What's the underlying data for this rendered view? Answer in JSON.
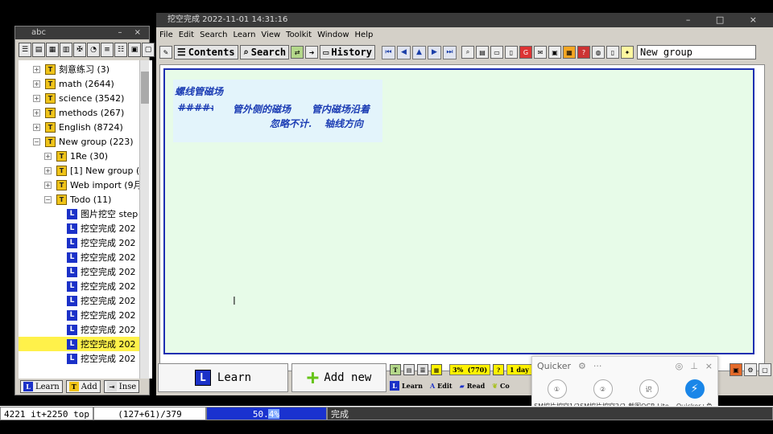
{
  "tree_window": {
    "title": "abc",
    "buttons": {
      "learn": "Learn",
      "add": "Add",
      "insert": "Inse"
    }
  },
  "tree": {
    "items": [
      {
        "label": "刻意练习 (3)"
      },
      {
        "label": "math (2644)"
      },
      {
        "label": "science (3542)"
      },
      {
        "label": "methods (267)"
      },
      {
        "label": "English (8724)"
      },
      {
        "label": "New group (223)"
      },
      {
        "label": "1Re (30)"
      },
      {
        "label": "[1] New group (1"
      },
      {
        "label": "Web import (9月"
      },
      {
        "label": "Todo (11)"
      },
      {
        "label": "图片挖空  step"
      },
      {
        "label": "挖空完成 202"
      },
      {
        "label": "挖空完成 202"
      },
      {
        "label": "挖空完成 202"
      },
      {
        "label": "挖空完成 202"
      },
      {
        "label": "挖空完成 202"
      },
      {
        "label": "挖空完成 202"
      },
      {
        "label": "挖空完成 202"
      },
      {
        "label": "挖空完成 202"
      },
      {
        "label": "挖空完成 202"
      },
      {
        "label": "挖空完成 202"
      }
    ]
  },
  "main_window": {
    "title": "挖空完成 2022-11-01 14:31:16",
    "menu": [
      "File",
      "Edit",
      "Search",
      "Learn",
      "View",
      "Toolkit",
      "Window",
      "Help"
    ],
    "toolbar": {
      "contents": "Contents",
      "search": "Search",
      "history": "History"
    },
    "group_field": "New group"
  },
  "card": {
    "handwriting": {
      "line1": "螺线管磁场",
      "line2a": "管外侧的磁场",
      "line2b": "管内磁场沿着",
      "line3a": "忽略不计.",
      "line3b": "轴线方向"
    }
  },
  "bottom": {
    "learn": "Learn",
    "add_new": "Add new",
    "mini": {
      "pct": "3%",
      "count": "(770)",
      "days": "1 day",
      "learn": "Learn",
      "edit": "Edit",
      "read": "Read",
      "co": "Co"
    }
  },
  "quicker": {
    "title": "Quicker",
    "items": [
      {
        "label": "SM挖片挖空1/2"
      },
      {
        "label": "SM挖片挖空2/2"
      },
      {
        "label": "截图OCR Lite"
      },
      {
        "label": "Quicker+负"
      }
    ]
  },
  "status_bar": {
    "counts": "4221 it+2250 top",
    "ratio": "(127+61)/379",
    "progress_label": "50.4%",
    "status": "完成"
  }
}
